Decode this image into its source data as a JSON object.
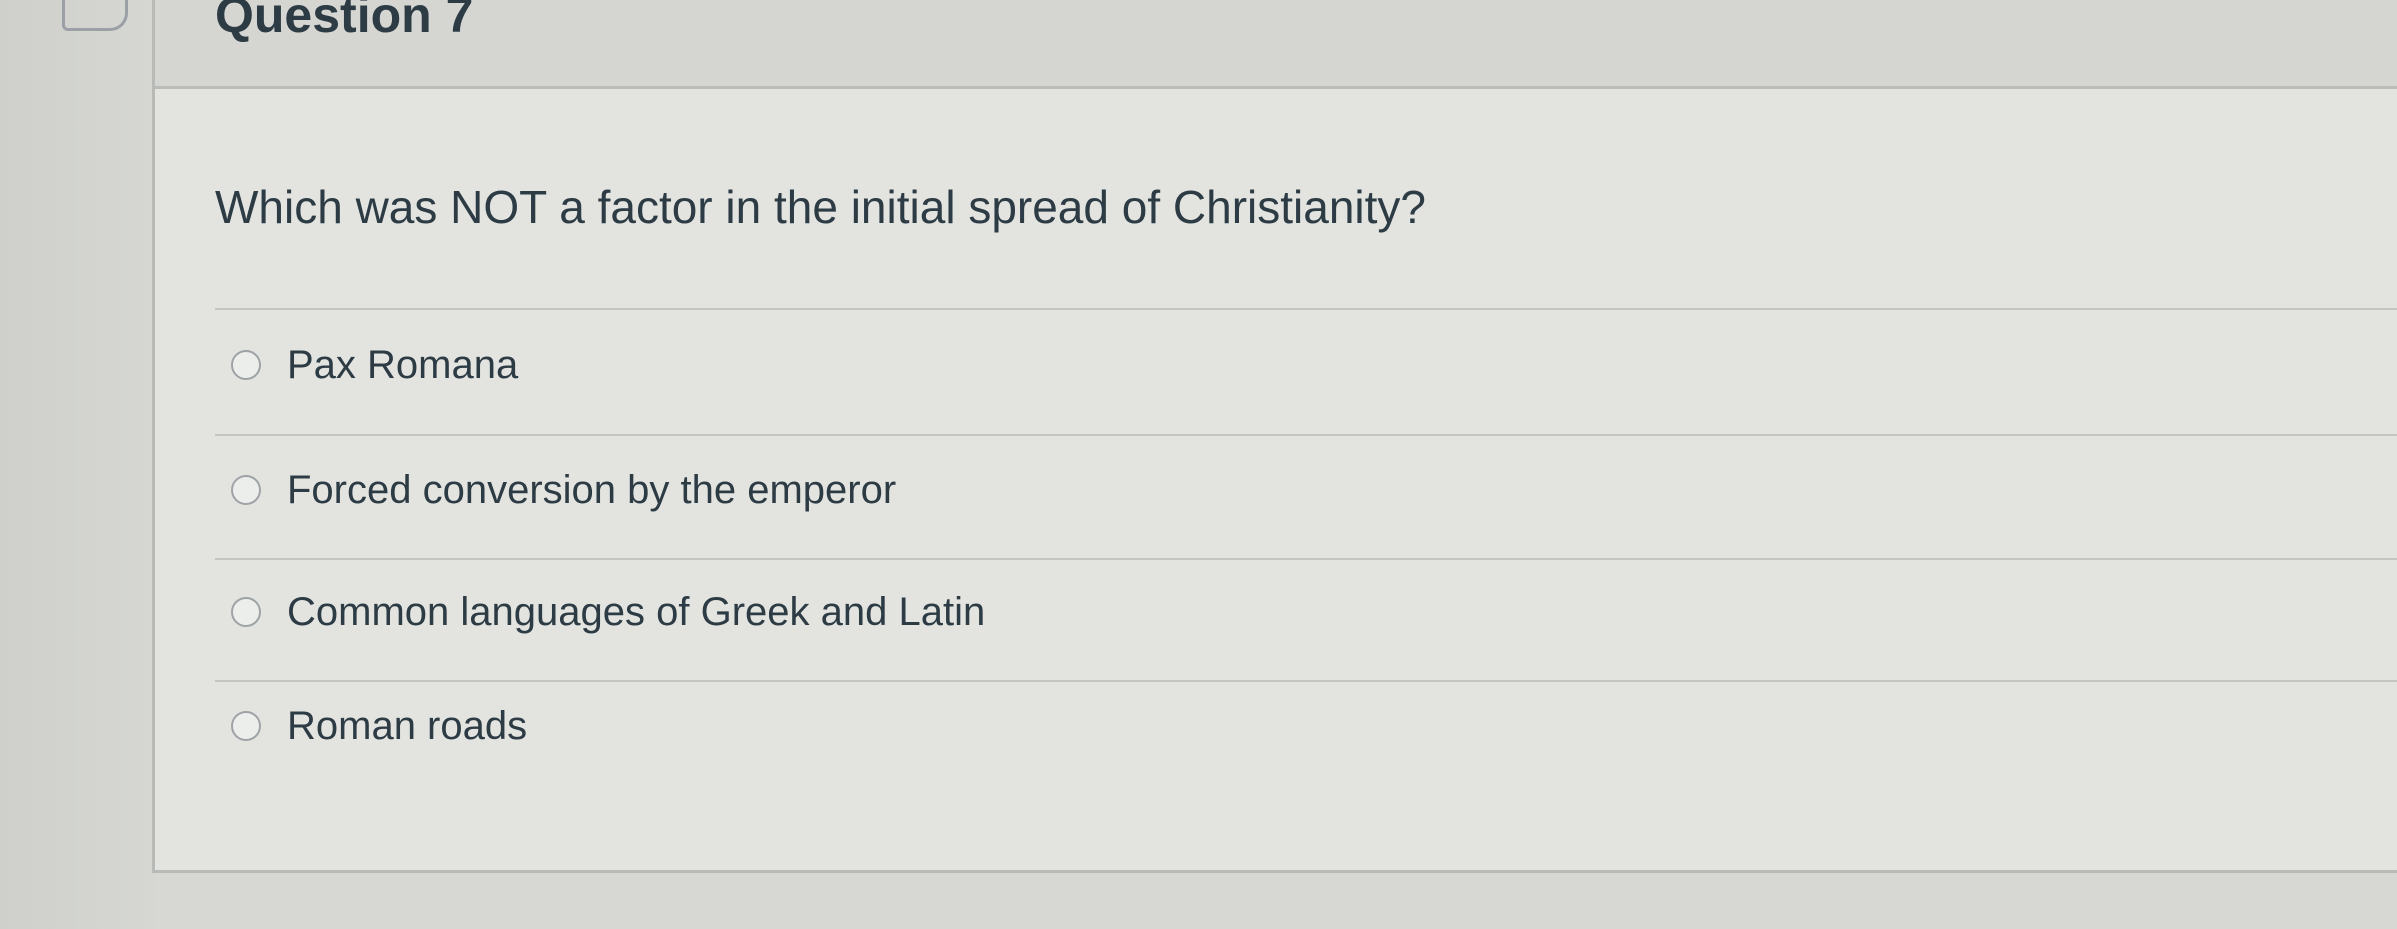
{
  "question": {
    "title": "Question 7",
    "prompt": "Which was NOT a factor in the initial spread of Christianity?",
    "answers": [
      {
        "label": "Pax Romana",
        "selected": false
      },
      {
        "label": "Forced conversion by the emperor",
        "selected": false
      },
      {
        "label": "Common languages of Greek and Latin",
        "selected": false
      },
      {
        "label": "Roman roads",
        "selected": false
      }
    ]
  },
  "icons": {
    "flag": "flag-icon"
  },
  "colors": {
    "text": "#2d3b45",
    "background": "#d7d8d4",
    "radio_border": "#9ea3a6"
  }
}
